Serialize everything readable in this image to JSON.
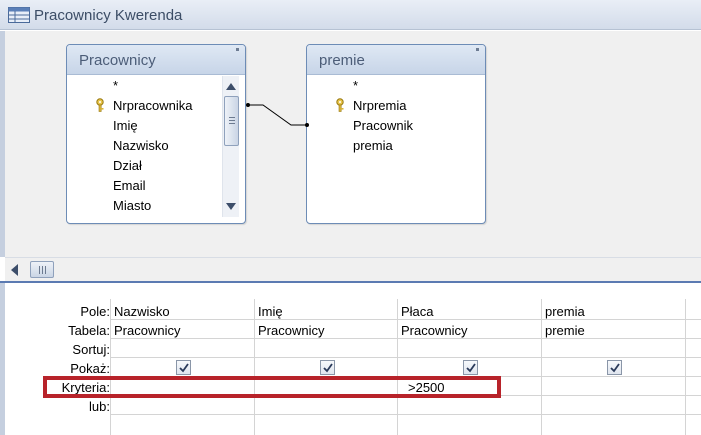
{
  "window": {
    "title": "Pracownicy Kwerenda",
    "icon": "query-icon"
  },
  "tables": [
    {
      "name": "Pracownicy",
      "fields": [
        "*",
        "Nrpracownika",
        "Imię",
        "Nazwisko",
        "Dział",
        "Email",
        "Miasto"
      ],
      "key_field": "Nrpracownika"
    },
    {
      "name": "premie",
      "fields": [
        "*",
        "Nrpremia",
        "Pracownik",
        "premia"
      ],
      "key_field": "Nrpremia"
    }
  ],
  "grid": {
    "row_labels": [
      "Pole:",
      "Tabela:",
      "Sortuj:",
      "Pokaż:",
      "Kryteria:",
      "lub:"
    ],
    "columns": [
      {
        "field": "Nazwisko",
        "table": "Pracownicy",
        "show": true,
        "criteria": ""
      },
      {
        "field": "Imię",
        "table": "Pracownicy",
        "show": true,
        "criteria": ""
      },
      {
        "field": "Płaca",
        "table": "Pracownicy",
        "show": true,
        "criteria": ">2500"
      },
      {
        "field": "premia",
        "table": "premie",
        "show": true,
        "criteria": ""
      }
    ]
  },
  "colors": {
    "highlight": "#b8232a",
    "title_text": "#3c4d66",
    "splitter": "#5b7ab2"
  }
}
